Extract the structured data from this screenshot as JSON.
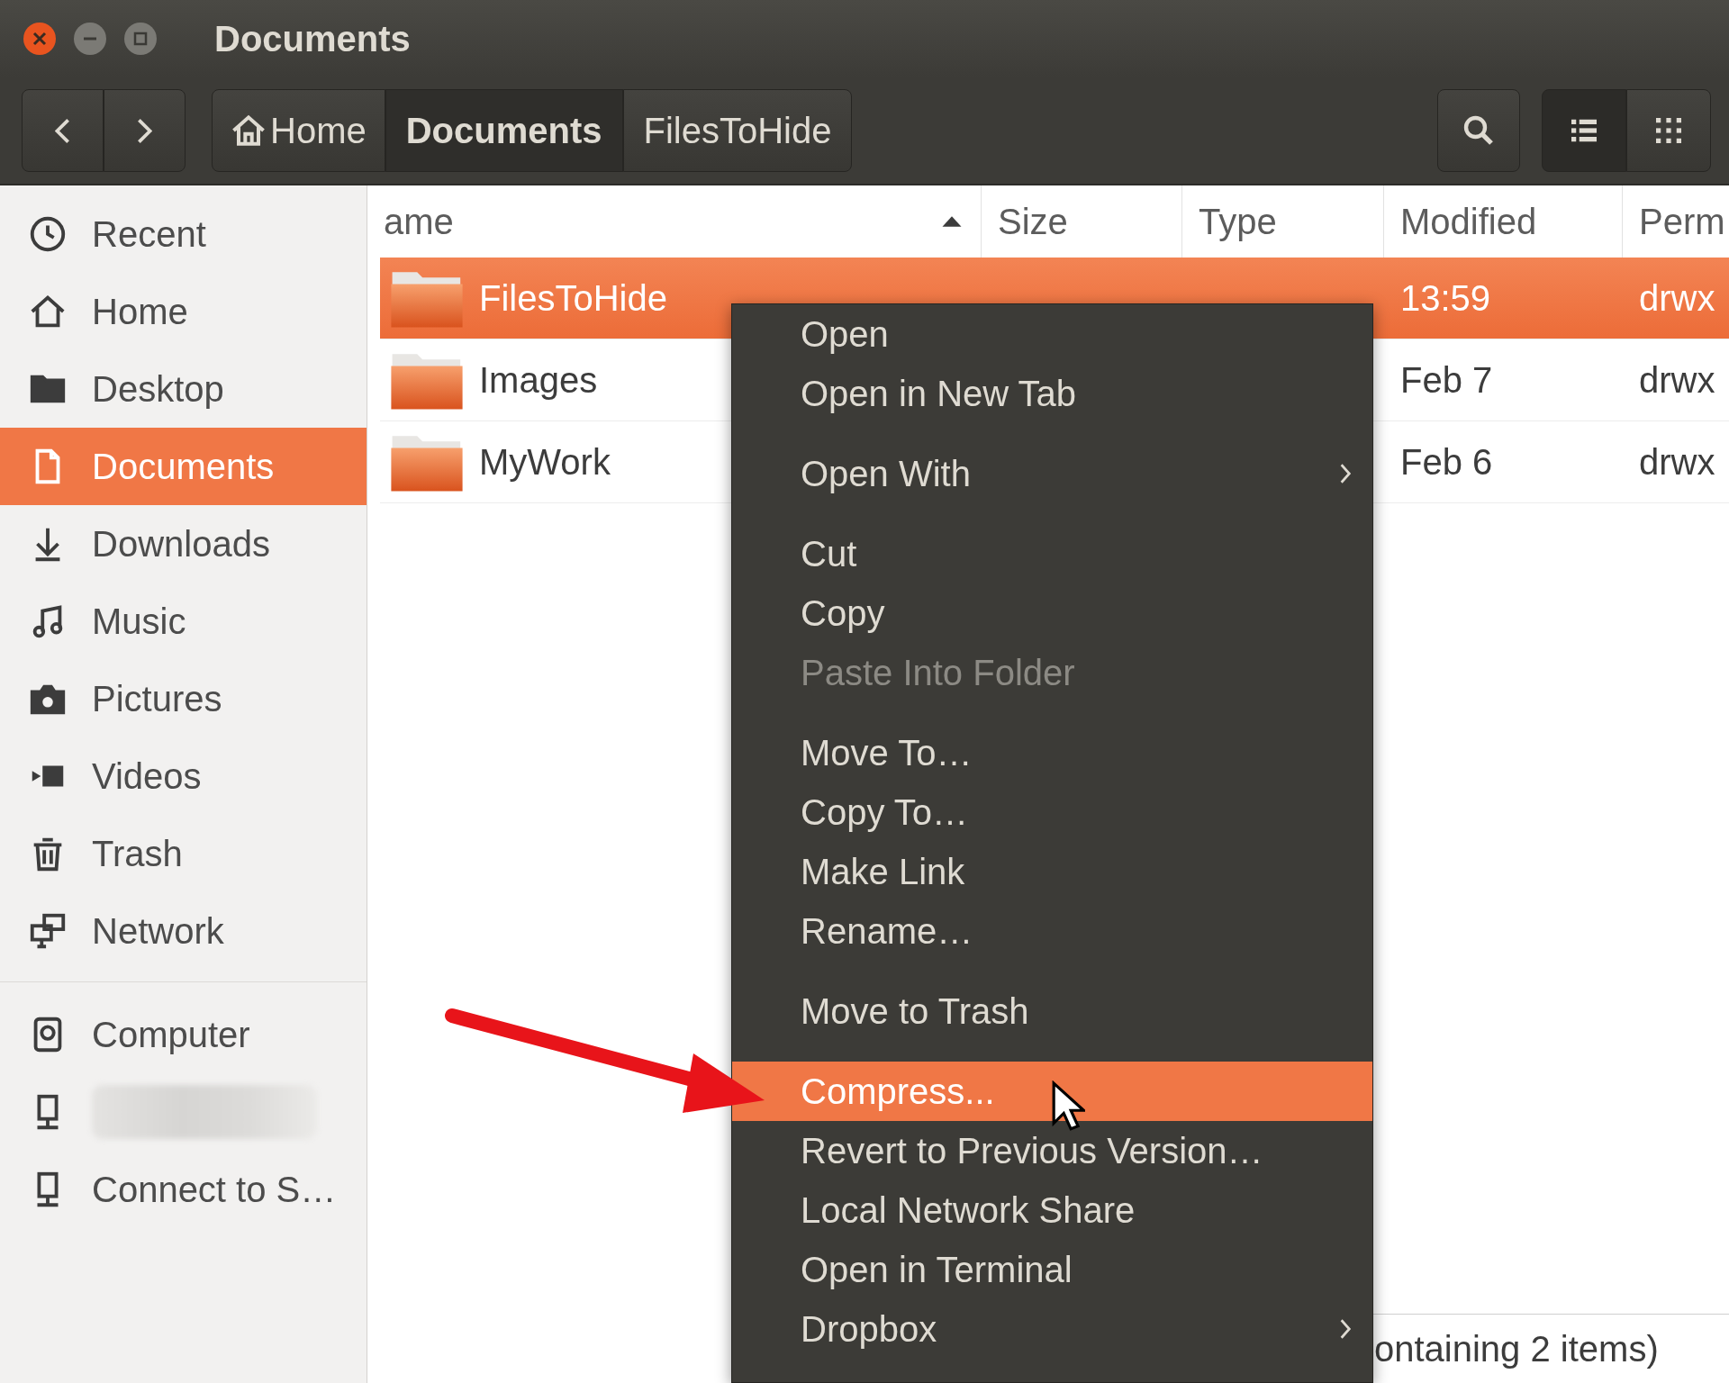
{
  "window": {
    "title": "Documents"
  },
  "breadcrumbs": [
    {
      "label": "Home",
      "kind": "home",
      "selected": false
    },
    {
      "label": "Documents",
      "kind": "folder",
      "selected": true
    },
    {
      "label": "FilesToHide",
      "kind": "folder",
      "selected": false
    }
  ],
  "view_buttons": [
    {
      "kind": "list",
      "selected": true
    },
    {
      "kind": "grid",
      "selected": false
    }
  ],
  "sidebar": {
    "sections": [
      {
        "items": [
          {
            "kind": "place",
            "label": "Recent",
            "selected": false
          },
          {
            "kind": "place",
            "label": "Home",
            "selected": false
          },
          {
            "kind": "place",
            "label": "Desktop",
            "selected": false
          },
          {
            "kind": "place",
            "label": "Documents",
            "selected": true
          },
          {
            "kind": "place",
            "label": "Downloads",
            "selected": false
          },
          {
            "kind": "place",
            "label": "Music",
            "selected": false
          },
          {
            "kind": "place",
            "label": "Pictures",
            "selected": false
          },
          {
            "kind": "place",
            "label": "Videos",
            "selected": false
          },
          {
            "kind": "place",
            "label": "Trash",
            "selected": false
          },
          {
            "kind": "place",
            "label": "Network",
            "selected": false
          }
        ]
      },
      {
        "items": [
          {
            "kind": "place",
            "label": "Computer",
            "selected": false
          },
          {
            "kind": "redacted",
            "selected": false
          },
          {
            "kind": "place",
            "label": "Connect to S…",
            "selected": false
          }
        ]
      }
    ]
  },
  "file_list": {
    "columns": [
      {
        "label": "ame",
        "sorted": true
      },
      {
        "label": "Size",
        "sorted": false
      },
      {
        "label": "Type",
        "sorted": false
      },
      {
        "label": "Modified",
        "sorted": false
      },
      {
        "label": "Perm",
        "sorted": false
      }
    ],
    "rows": [
      {
        "name": "FilesToHide",
        "modified": "13:59",
        "permissions": "drwx",
        "selected": true
      },
      {
        "name": "Images",
        "modified": "Feb 7",
        "permissions": "drwx",
        "selected": false
      },
      {
        "name": "MyWork",
        "modified": "Feb 6",
        "permissions": "drwx",
        "selected": false
      }
    ]
  },
  "context_menu": {
    "groups": [
      [
        {
          "label": "Open",
          "disabled": false,
          "selected": false,
          "submenu": false
        },
        {
          "label": "Open in New Tab",
          "disabled": false,
          "selected": false,
          "submenu": false
        }
      ],
      [
        {
          "label": "Open With",
          "disabled": false,
          "selected": false,
          "submenu": true
        }
      ],
      [
        {
          "label": "Cut",
          "disabled": false,
          "selected": false,
          "submenu": false
        },
        {
          "label": "Copy",
          "disabled": false,
          "selected": false,
          "submenu": false
        },
        {
          "label": "Paste Into Folder",
          "disabled": true,
          "selected": false,
          "submenu": false
        }
      ],
      [
        {
          "label": "Move To…",
          "disabled": false,
          "selected": false,
          "submenu": false
        },
        {
          "label": "Copy To…",
          "disabled": false,
          "selected": false,
          "submenu": false
        },
        {
          "label": "Make Link",
          "disabled": false,
          "selected": false,
          "submenu": false
        },
        {
          "label": "Rename…",
          "disabled": false,
          "selected": false,
          "submenu": false
        }
      ],
      [
        {
          "label": "Move to Trash",
          "disabled": false,
          "selected": false,
          "submenu": false
        }
      ],
      [
        {
          "label": "Compress...",
          "disabled": false,
          "selected": true,
          "submenu": false
        },
        {
          "label": "Revert to Previous Version…",
          "disabled": false,
          "selected": false,
          "submenu": false
        },
        {
          "label": "Local Network Share",
          "disabled": false,
          "selected": false,
          "submenu": false
        },
        {
          "label": "Open in Terminal",
          "disabled": false,
          "selected": false,
          "submenu": false
        },
        {
          "label": "Dropbox",
          "disabled": false,
          "selected": false,
          "submenu": true
        }
      ]
    ]
  },
  "status_bar": {
    "text": "ontaining 2 items)"
  }
}
